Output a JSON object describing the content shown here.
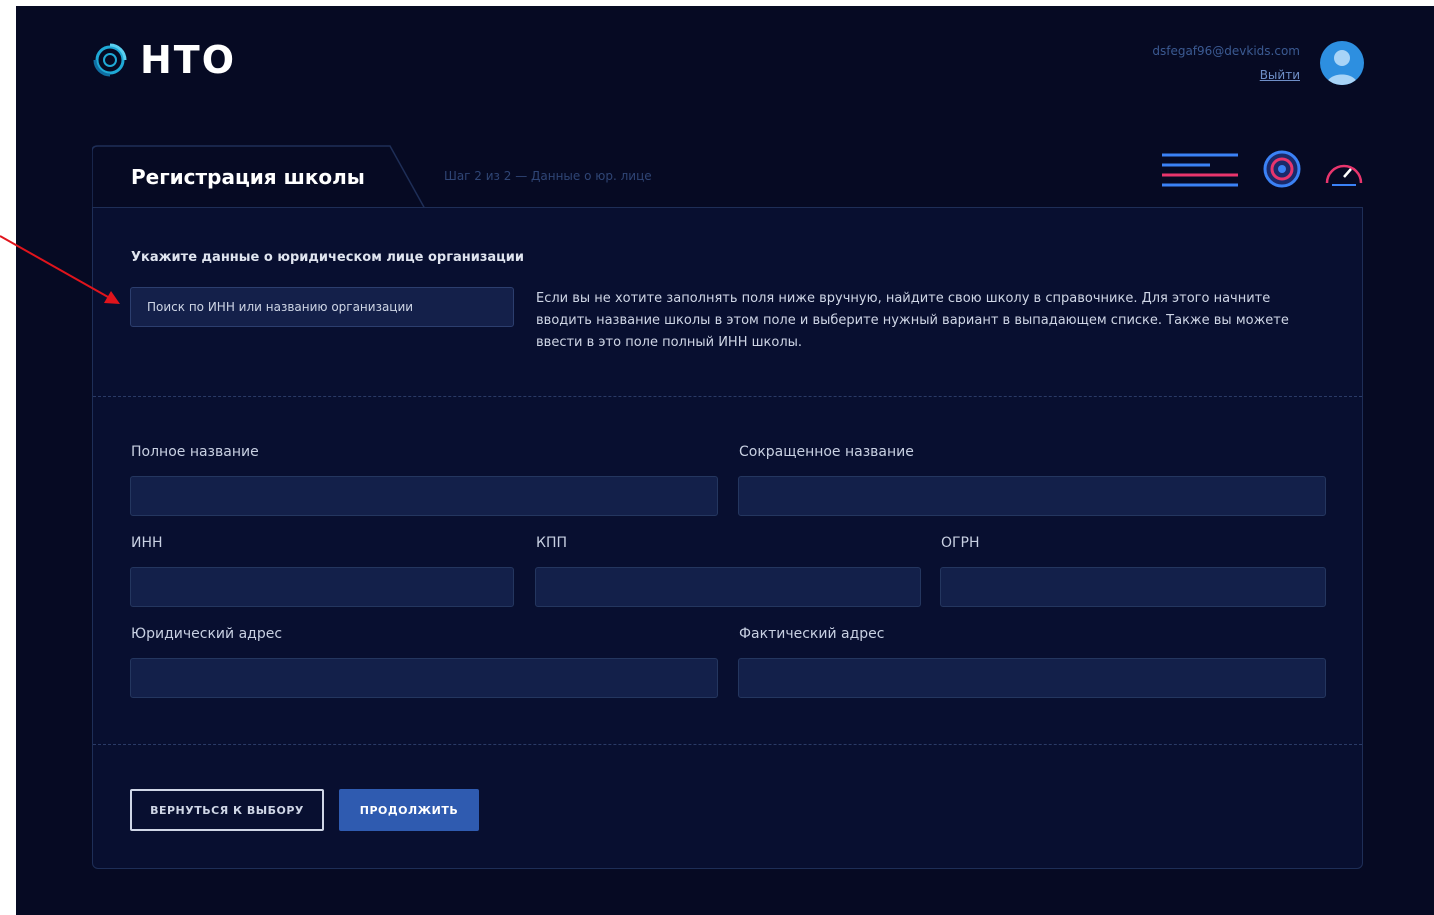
{
  "brand": {
    "name": "НТО"
  },
  "user": {
    "email": "dsfegaf96@devkids.com",
    "logout": "Выйти"
  },
  "tab": {
    "title": "Регистрация школы",
    "step": "Шаг 2 из 2 — Данные о юр. лице"
  },
  "legal": {
    "title": "Укажите данные о юридическом лице организации",
    "search_placeholder": "Поиск по ИНН или названию организации",
    "hint": "Если вы не хотите заполнять поля ниже вручную, найдите свою школу в справочнике. Для этого начните вводить название школы в этом поле и выберите нужный вариант в выпадающем списке. Также вы можете ввести в это поле полный ИНН школы."
  },
  "fields": {
    "full_name": "Полное название",
    "short_name": "Сокращенное название",
    "inn": "ИНН",
    "kpp": "КПП",
    "ogrn": "ОГРН",
    "legal_address": "Юридический адрес",
    "actual_address": "Фактический адрес"
  },
  "buttons": {
    "back": "ВЕРНУТЬСЯ К ВЫБОРУ",
    "next": "ПРОДОЛЖИТЬ"
  },
  "icons": [
    "logo-icon",
    "avatar-icon",
    "menu-lines-icon",
    "target-icon",
    "gauge-icon",
    "arrow-annotation"
  ],
  "colors": {
    "background": "#060a23",
    "accent": "#2f5bb0",
    "pink": "#e8356d",
    "blue": "#3b82f6"
  }
}
